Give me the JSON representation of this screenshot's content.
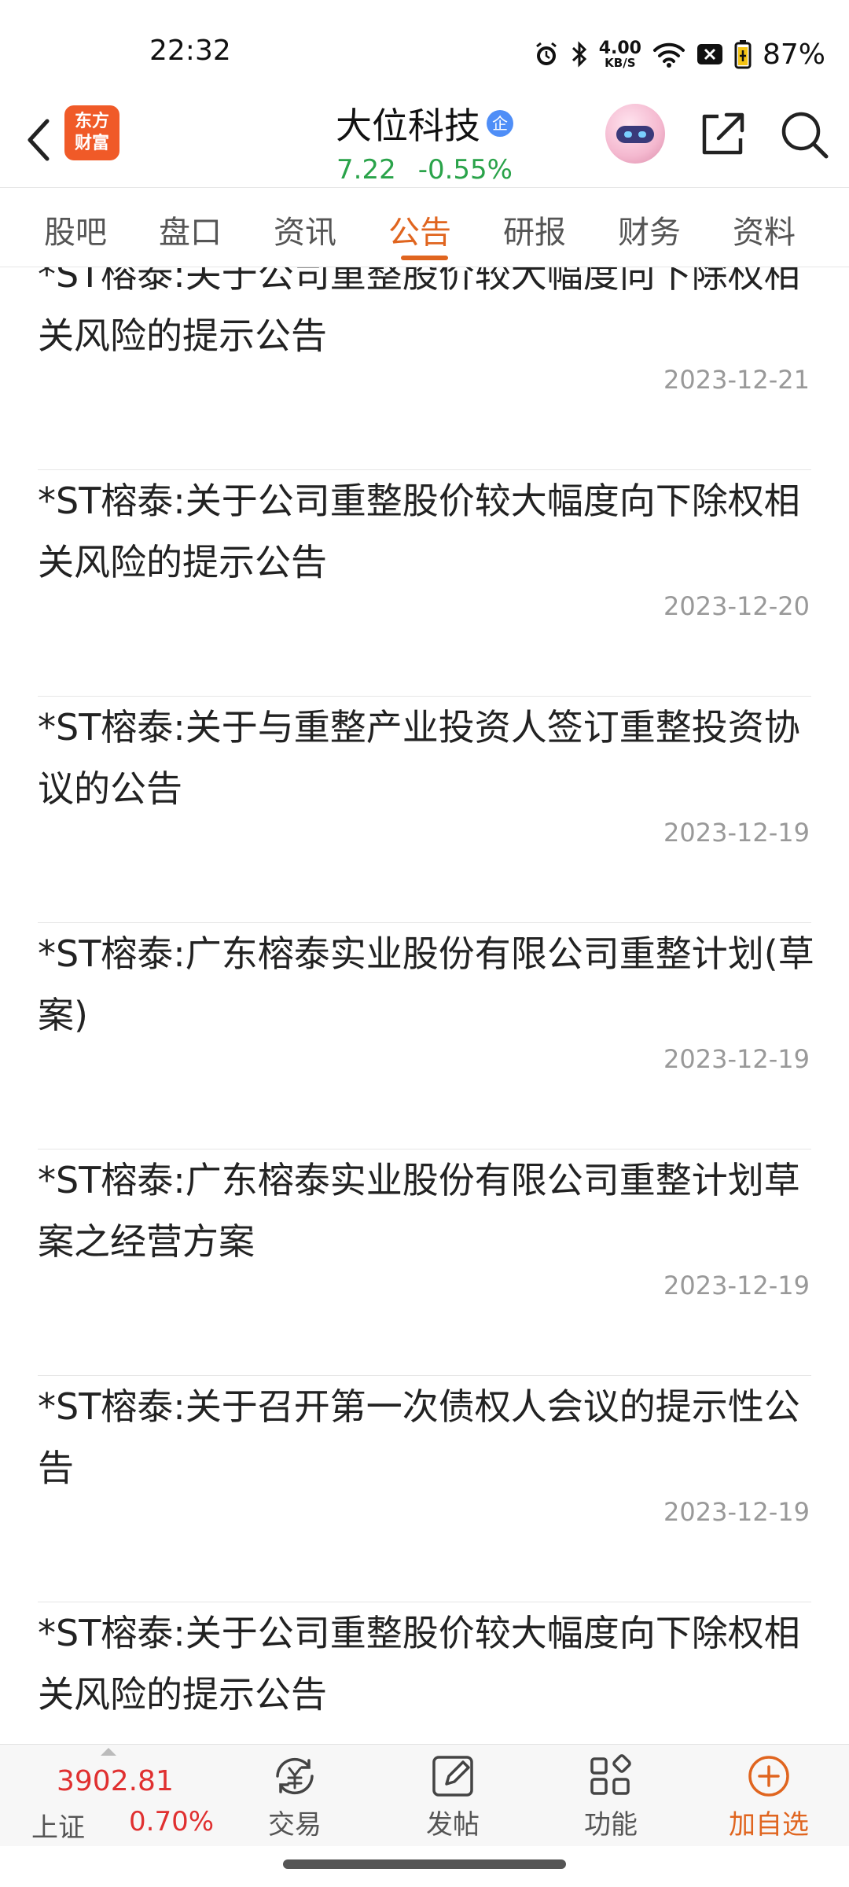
{
  "status_bar": {
    "time": "22:32",
    "net_speed_value": "4.00",
    "net_speed_unit": "KB/S",
    "battery_percent": "87%",
    "icons": [
      "alarm-icon",
      "bluetooth-icon",
      "wifi-icon",
      "sim-blocked-icon",
      "battery-icon"
    ]
  },
  "header": {
    "logo_line1": "东方",
    "logo_line2": "财富",
    "stock_name": "大位科技",
    "badge": "企",
    "price": "7.22",
    "change_pct": "-0.55%",
    "icons": [
      "back-icon",
      "robot-assistant-icon",
      "share-icon",
      "search-icon"
    ]
  },
  "tabs": [
    {
      "label": "股吧"
    },
    {
      "label": "盘口"
    },
    {
      "label": "资讯"
    },
    {
      "label": "公告"
    },
    {
      "label": "研报"
    },
    {
      "label": "财务"
    },
    {
      "label": "资料"
    }
  ],
  "active_tab": "公告",
  "announcements": [
    {
      "title": "*ST榕泰:关于公司重整股价较大幅度向下除权相关风险的提示公告",
      "date": "2023-12-21"
    },
    {
      "title": "*ST榕泰:关于公司重整股价较大幅度向下除权相关风险的提示公告",
      "date": "2023-12-20"
    },
    {
      "title": "*ST榕泰:关于与重整产业投资人签订重整投资协议的公告",
      "date": "2023-12-19"
    },
    {
      "title": "*ST榕泰:广东榕泰实业股份有限公司重整计划(草案)",
      "date": "2023-12-19"
    },
    {
      "title": "*ST榕泰:广东榕泰实业股份有限公司重整计划草案之经营方案",
      "date": "2023-12-19"
    },
    {
      "title": "*ST榕泰:关于召开第一次债权人会议的提示性公告",
      "date": "2023-12-19"
    },
    {
      "title": "*ST榕泰:关于公司重整股价较大幅度向下除权相关风险的提示公告",
      "date": ""
    }
  ],
  "bottom_bar": {
    "index_value": "3902.81",
    "index_name": "上证",
    "index_change": "0.70%",
    "nav": [
      {
        "label": "交易",
        "icon": "trade-icon"
      },
      {
        "label": "发帖",
        "icon": "post-icon"
      },
      {
        "label": "功能",
        "icon": "functions-icon"
      },
      {
        "label": "加自选",
        "icon": "add-watchlist-icon"
      }
    ]
  },
  "colors": {
    "accent": "#e0651f",
    "price_down": "#2aa34a",
    "price_up": "#e03030",
    "logo": "#f05a28"
  }
}
